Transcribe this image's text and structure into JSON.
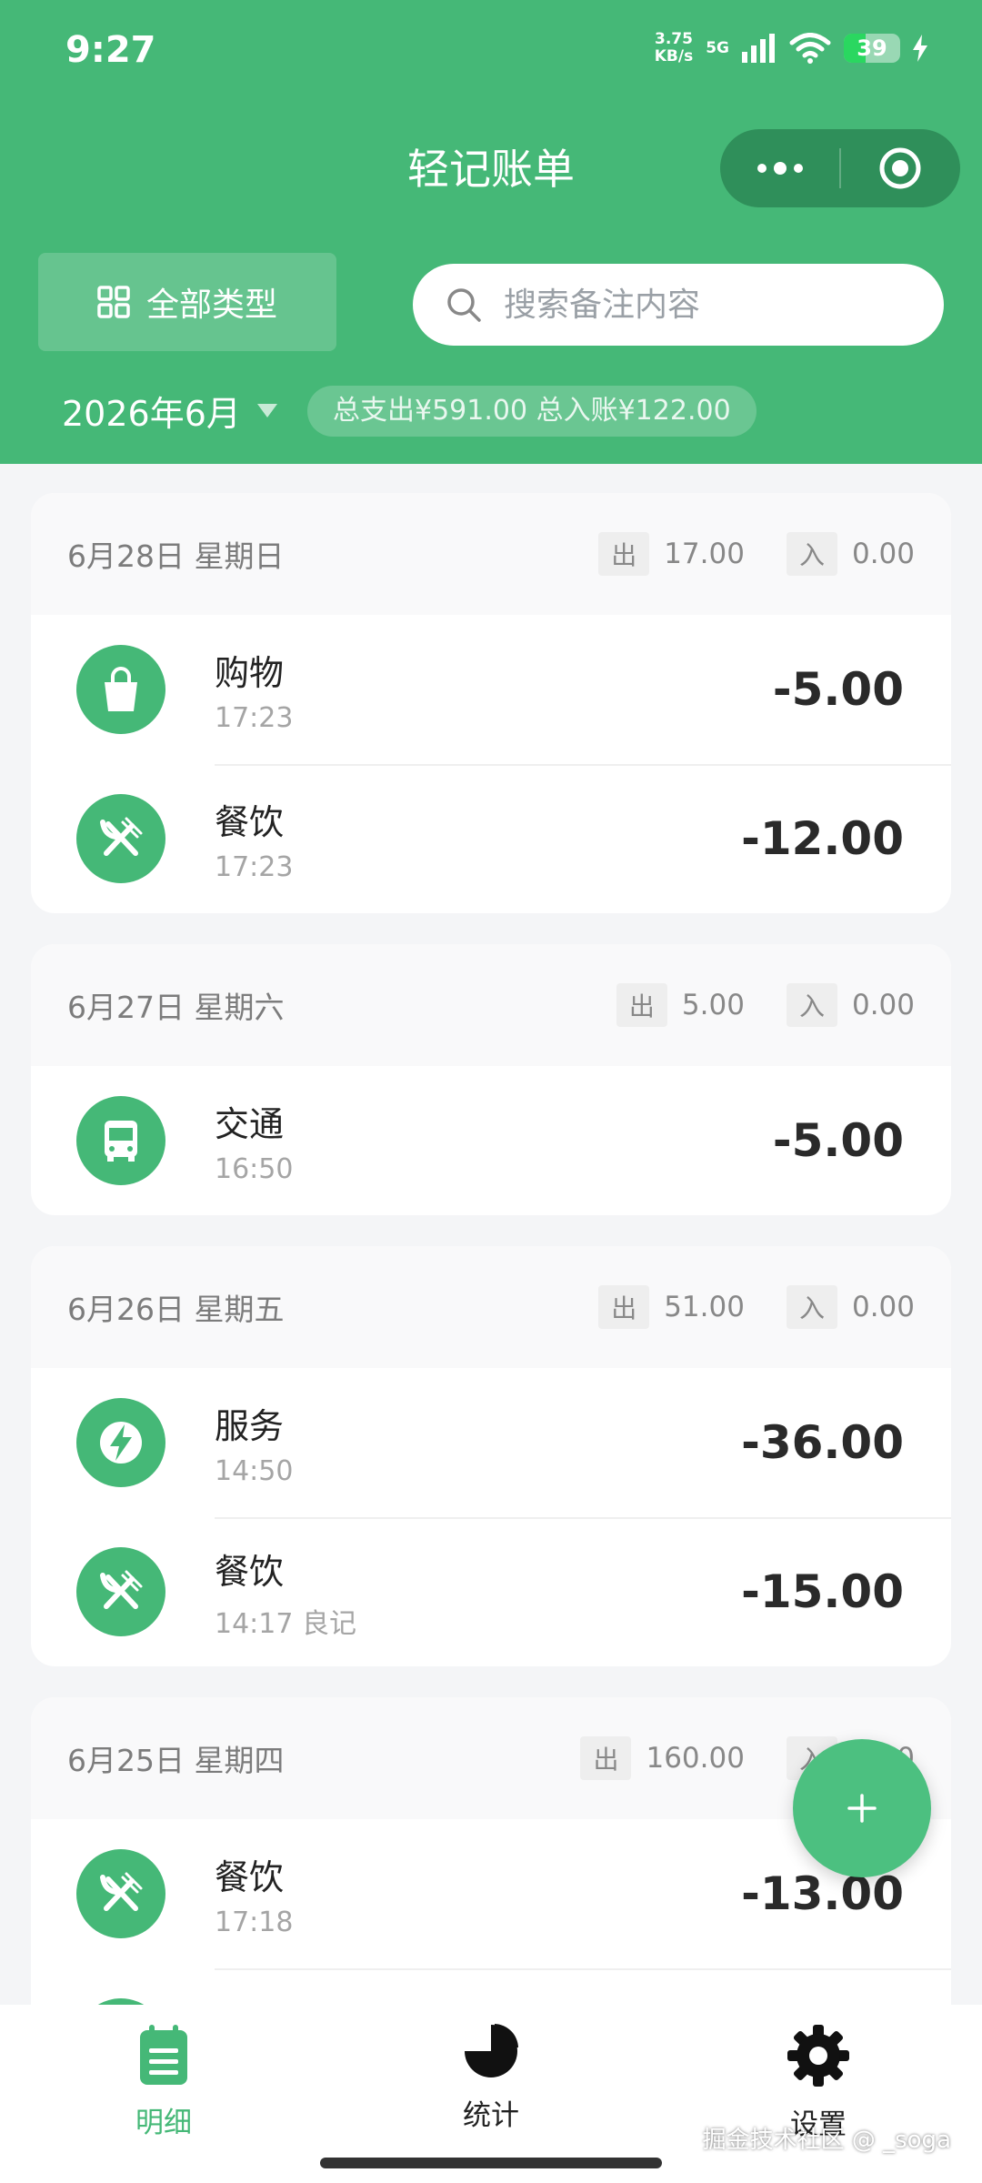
{
  "status": {
    "time": "9:27",
    "net_speed_top": "3.75",
    "net_speed_bottom": "KB/s",
    "signal_label": "5G",
    "battery": "39",
    "battery_level": 0.39
  },
  "header": {
    "title": "轻记账单",
    "type_filter": "全部类型",
    "search_placeholder": "搜索备注内容",
    "month": "2026年6月",
    "summary": "总支出¥591.00 总入账¥122.00"
  },
  "labels": {
    "out": "出",
    "in": "入"
  },
  "days": [
    {
      "date": "6月28日 星期日",
      "out": "17.00",
      "in": "0.00",
      "items": [
        {
          "icon": "shopping-bag-icon",
          "name": "购物",
          "sub": "17:23",
          "amount": "-5.00"
        },
        {
          "icon": "utensils-icon",
          "name": "餐饮",
          "sub": "17:23",
          "amount": "-12.00"
        }
      ]
    },
    {
      "date": "6月27日 星期六",
      "out": "5.00",
      "in": "0.00",
      "items": [
        {
          "icon": "bus-icon",
          "name": "交通",
          "sub": "16:50",
          "amount": "-5.00"
        }
      ]
    },
    {
      "date": "6月26日 星期五",
      "out": "51.00",
      "in": "0.00",
      "items": [
        {
          "icon": "lightning-icon",
          "name": "服务",
          "sub": "14:50",
          "amount": "-36.00"
        },
        {
          "icon": "utensils-icon",
          "name": "餐饮",
          "sub": "14:17 良记",
          "amount": "-15.00"
        }
      ]
    },
    {
      "date": "6月25日 星期四",
      "out": "160.00",
      "in": "0.00",
      "items": [
        {
          "icon": "utensils-icon",
          "name": "餐饮",
          "sub": "17:18",
          "amount": "-13.00"
        },
        {
          "icon": "utensils-icon",
          "name": "",
          "sub": "",
          "amount": ""
        }
      ]
    }
  ],
  "tabs": [
    {
      "label": "明细",
      "icon": "notebook-icon",
      "active": true
    },
    {
      "label": "统计",
      "icon": "pie-chart-icon",
      "active": false
    },
    {
      "label": "设置",
      "icon": "gear-icon",
      "active": false
    }
  ],
  "watermark": "掘金技术社区 @ _soga",
  "colors": {
    "brand": "#45b877",
    "brand_dark": "#2f8f5a",
    "fab": "#4cc080"
  }
}
